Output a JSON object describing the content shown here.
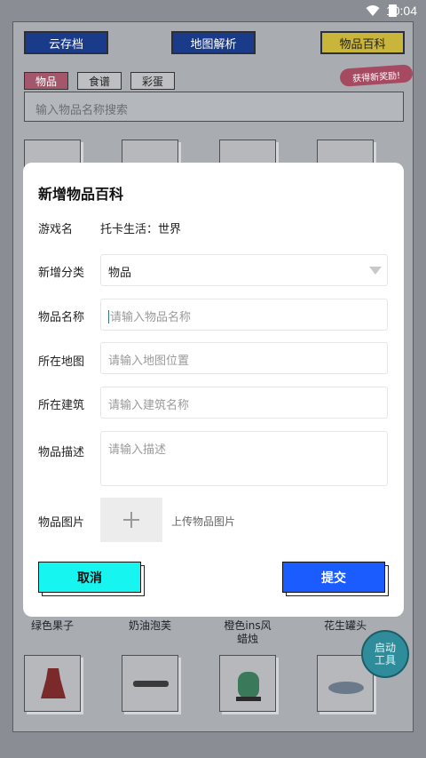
{
  "status_bar": {
    "time": "10:04"
  },
  "background": {
    "top_buttons": [
      "云存档",
      "地图解析",
      "物品百科"
    ],
    "new_badge": "获得新奖励!",
    "chips": [
      "物品",
      "食谱",
      "彩蛋"
    ],
    "search_placeholder": "输入物品名称搜索",
    "item_labels": [
      "绿色果子",
      "奶油泡芙",
      "橙色ins风\n蜡烛",
      "花生罐头"
    ],
    "launch_tool": "启动\n工具"
  },
  "dialog": {
    "title": "新增物品百科",
    "game_label": "游戏名",
    "game_value": "托卡生活：世界",
    "category_label": "新增分类",
    "category_value": "物品",
    "name_label": "物品名称",
    "name_placeholder": "请输入物品名称",
    "map_label": "所在地图",
    "map_placeholder": "请输入地图位置",
    "building_label": "所在建筑",
    "building_placeholder": "请输入建筑名称",
    "desc_label": "物品描述",
    "desc_placeholder": "请输入描述",
    "image_label": "物品图片",
    "upload_hint": "上传物品图片",
    "cancel_label": "取消",
    "submit_label": "提交"
  }
}
